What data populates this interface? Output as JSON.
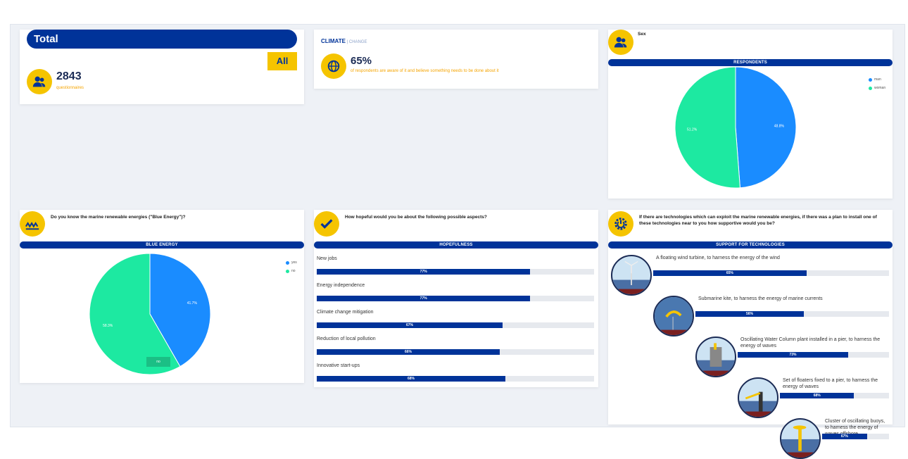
{
  "total_card": {
    "title": "Total",
    "filter_button": "All",
    "count": "2843",
    "count_label": "questionnaires"
  },
  "climate_card": {
    "title_bold": "CLIMATE",
    "title_light": " | CHANGE",
    "percent": "65%",
    "description": "of respondents are aware of it and believe something needs to be done about it"
  },
  "sex_card": {
    "question": "Sex",
    "band": "RESPONDENTS",
    "legend": [
      {
        "label": "man",
        "color": "#1a8cff"
      },
      {
        "label": "woman",
        "color": "#1de9a1"
      }
    ],
    "chart_data": {
      "type": "pie",
      "labels": [
        "man",
        "woman"
      ],
      "values": [
        48.8,
        51.2
      ],
      "value_labels": [
        "48.8%",
        "51.2%"
      ],
      "colors": [
        "#1a8cff",
        "#1de9a1"
      ]
    }
  },
  "blue_energy_card": {
    "question": "Do you know the marine renewable energies (\"Blue Energy\")?",
    "band": "BLUE ENERGY",
    "legend": [
      {
        "label": "yes",
        "color": "#1a8cff"
      },
      {
        "label": "no",
        "color": "#1de9a1"
      }
    ],
    "tooltip": "no",
    "chart_data": {
      "type": "pie",
      "labels": [
        "yes",
        "no"
      ],
      "values": [
        41.7,
        58.3
      ],
      "value_labels": [
        "41.7%",
        "58.3%"
      ],
      "colors": [
        "#1a8cff",
        "#1de9a1"
      ]
    }
  },
  "hopefulness_card": {
    "question": "How hopeful would you be about the following possible aspects?",
    "band": "HOPEFULNESS",
    "chart_data": {
      "type": "bar",
      "categories": [
        "New jobs",
        "Energy independence",
        "Climate change mitigation",
        "Reduction of local pollution",
        "Innovative start-ups"
      ],
      "values": [
        77,
        77,
        67,
        66,
        68
      ],
      "value_labels": [
        "77%",
        "77%",
        "67%",
        "66%",
        "68%"
      ],
      "xlim": [
        0,
        100
      ]
    }
  },
  "technologies_card": {
    "question": "If there are technologies which can exploit the marine renewable energies, if there was a plan to install one of these technologies near to you how supportive would you be?",
    "band": "SUPPORT FOR TECHNOLOGIES",
    "chart_data": {
      "type": "bar",
      "categories": [
        "A floating wind turbine, to harness the energy of the wind",
        "Submarine kite, to harness the energy of marine currents",
        "Oscillating Water Column plant installed in a pier, to harness the energy of waves",
        "Set of floaters fixed to a pier, to harness the energy of waves",
        "Cluster of oscillating buoys, to harness the energy of waves offshore"
      ],
      "values": [
        65,
        56,
        73,
        68,
        67
      ],
      "value_labels": [
        "65%",
        "56%",
        "73%",
        "68%",
        "67%"
      ],
      "xlim": [
        0,
        100
      ]
    }
  },
  "colors": {
    "navy": "#003399",
    "accent_yellow": "#f5c400",
    "pie_blue": "#1a8cff",
    "pie_green": "#1de9a1"
  }
}
